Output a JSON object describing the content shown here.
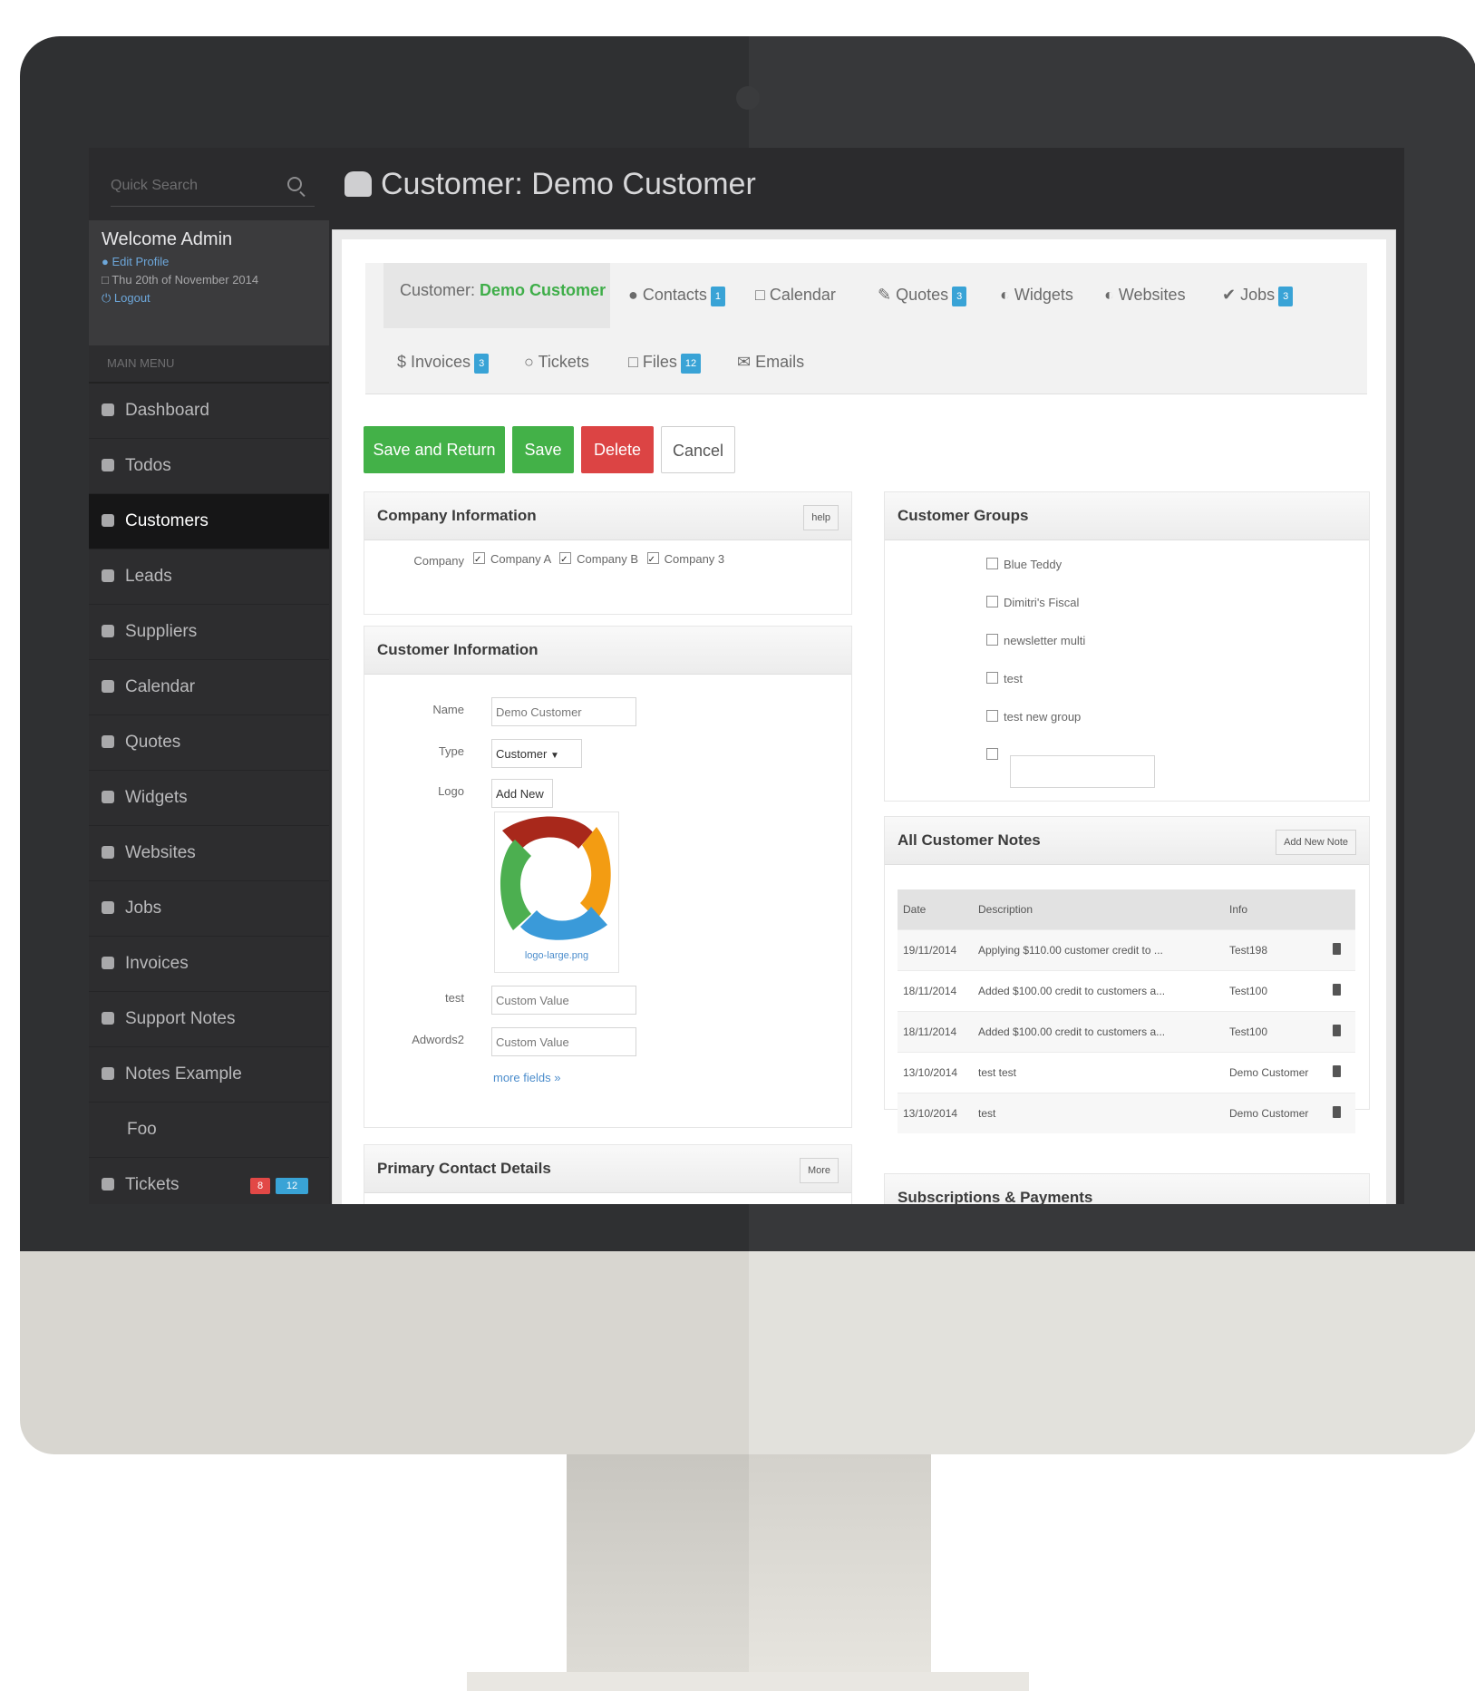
{
  "quick_search": {
    "placeholder": "Quick Search"
  },
  "header": {
    "title": "Customer: Demo Customer"
  },
  "welcome": {
    "title": "Welcome Admin",
    "profile": "Edit Profile",
    "date": "Thu 20th of November 2014",
    "logout": "Logout"
  },
  "main_menu_label": "MAIN MENU",
  "sidebar": {
    "items": [
      {
        "label": "Dashboard"
      },
      {
        "label": "Todos"
      },
      {
        "label": "Customers"
      },
      {
        "label": "Leads"
      },
      {
        "label": "Suppliers"
      },
      {
        "label": "Calendar"
      },
      {
        "label": "Quotes"
      },
      {
        "label": "Widgets"
      },
      {
        "label": "Websites"
      },
      {
        "label": "Jobs"
      },
      {
        "label": "Invoices"
      },
      {
        "label": "Support Notes"
      },
      {
        "label": "Notes Example"
      },
      {
        "label": "Foo"
      },
      {
        "label": "Tickets",
        "badge1": "8",
        "badge2": "12"
      }
    ]
  },
  "tabs": {
    "customer_prefix": "Customer:",
    "customer_name": "Demo Customer",
    "contacts": "Contacts",
    "contacts_badge": "1",
    "calendar": "Calendar",
    "quotes": "Quotes",
    "quotes_badge": "3",
    "widgets": "Widgets",
    "websites": "Websites",
    "jobs": "Jobs",
    "jobs_badge": "3",
    "invoices": "Invoices",
    "invoices_badge": "3",
    "tickets": "Tickets",
    "files": "Files",
    "files_badge": "12",
    "emails": "Emails"
  },
  "actions": {
    "save_return": "Save and Return",
    "save": "Save",
    "delete": "Delete",
    "cancel": "Cancel"
  },
  "company_info": {
    "title": "Company Information",
    "help": "help",
    "label": "Company",
    "companies": [
      "Company A",
      "Company B",
      "Company 3"
    ]
  },
  "customer_info": {
    "title": "Customer Information",
    "name_label": "Name",
    "name_value": "Demo Customer",
    "type_label": "Type",
    "type_value": "Customer",
    "logo_label": "Logo",
    "add_new": "Add New",
    "logo_file": "logo-large.png",
    "test_label": "test",
    "test_value": "Custom Value",
    "adwords_label": "Adwords2",
    "adwords_value": "Custom Value",
    "more_fields": "more fields »"
  },
  "primary_contact": {
    "title": "Primary Contact Details",
    "more": "More"
  },
  "customer_groups": {
    "title": "Customer Groups",
    "groups": [
      "Blue Teddy",
      "Dimitri's Fiscal",
      "newsletter multi",
      "test",
      "test new group"
    ]
  },
  "notes": {
    "title": "All Customer Notes",
    "add_button": "Add New Note",
    "headers": [
      "Date",
      "Description",
      "Info"
    ],
    "rows": [
      {
        "date": "19/11/2014",
        "desc": "Applying $110.00 customer credit to ...",
        "info": "Test198"
      },
      {
        "date": "18/11/2014",
        "desc": "Added $100.00 credit to customers a...",
        "info": "Test100"
      },
      {
        "date": "18/11/2014",
        "desc": "Added $100.00 credit to customers a...",
        "info": "Test100"
      },
      {
        "date": "13/10/2014",
        "desc": "test test",
        "info": "Demo Customer"
      },
      {
        "date": "13/10/2014",
        "desc": "test",
        "info": "Demo Customer"
      }
    ]
  },
  "subscriptions": {
    "title": "Subscriptions & Payments"
  }
}
